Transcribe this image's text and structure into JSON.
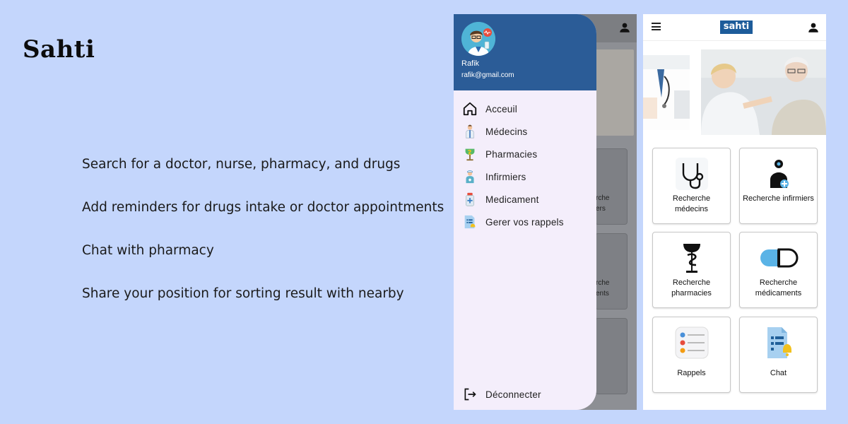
{
  "app_title": "Sahti",
  "features": [
    "Search for a doctor, nurse, pharmacy, and drugs",
    "Add reminders for drugs intake or doctor appointments",
    "Chat with pharmacy",
    "Share your position for sorting result with nearby"
  ],
  "drawer": {
    "user_name": "Rafik",
    "user_email": "rafik@gmail.com",
    "items": [
      {
        "label": "Acceuil",
        "icon": "home-icon"
      },
      {
        "label": "Médecins",
        "icon": "doctor-icon"
      },
      {
        "label": "Pharmacies",
        "icon": "pharmacy-icon"
      },
      {
        "label": "Infirmiers",
        "icon": "nurse-icon"
      },
      {
        "label": "Medicament",
        "icon": "medicine-icon"
      },
      {
        "label": "Gerer vos rappels",
        "icon": "reminders-icon"
      }
    ],
    "logout_label": "Déconnecter"
  },
  "background_card_fragments": [
    "rche",
    "ers",
    "rche",
    "ents"
  ],
  "home": {
    "logo_text": "sahti",
    "cards": [
      {
        "label": "Recherche médecins",
        "icon": "stethoscope-icon"
      },
      {
        "label": "Recherche infirmiers",
        "icon": "nurse-icon"
      },
      {
        "label": "Recherche pharmacies",
        "icon": "pharmacy-snake-icon"
      },
      {
        "label": "Recherche médicaments",
        "icon": "pill-icon"
      },
      {
        "label": "Rappels",
        "icon": "reminder-list-icon"
      },
      {
        "label": "Chat",
        "icon": "chat-document-icon"
      }
    ]
  },
  "colors": {
    "page_background": "#c4d6fc",
    "drawer_header": "#2b5c97",
    "drawer_background": "#f4eefb",
    "logo_background": "#1d5c9a"
  }
}
